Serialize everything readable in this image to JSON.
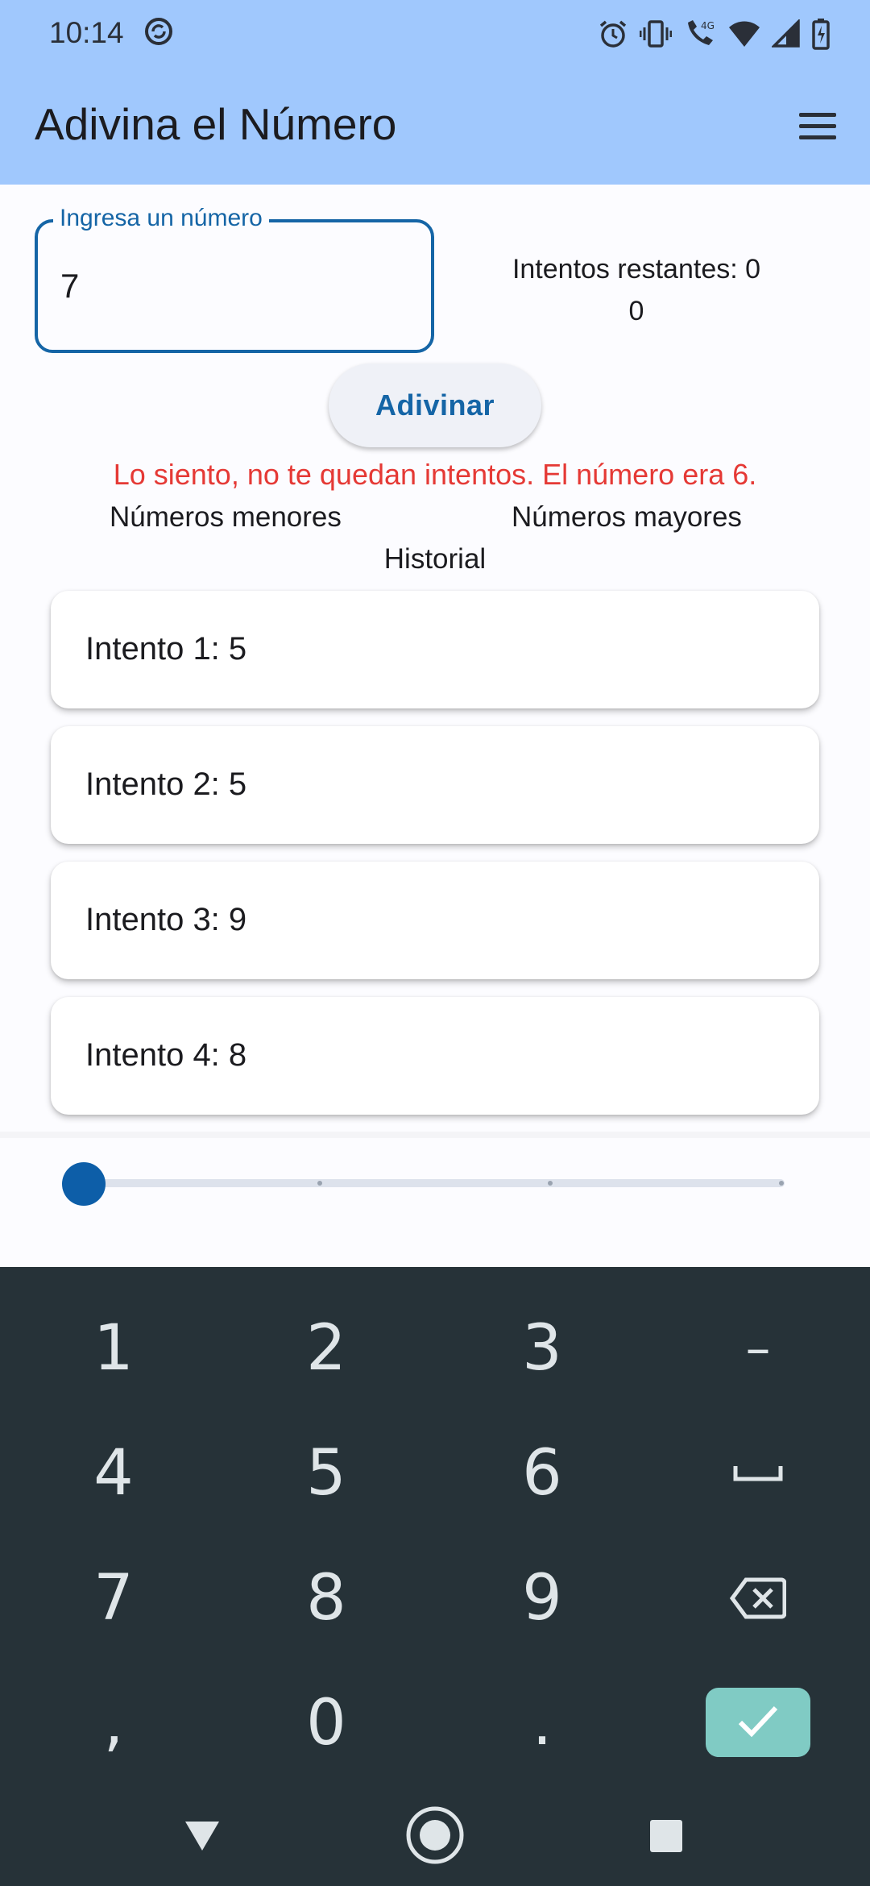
{
  "status_bar": {
    "time": "10:14",
    "icons": [
      "sync-icon",
      "alarm-icon",
      "vibrate-icon",
      "wifi-calling-icon",
      "wifi-icon",
      "signal-icon",
      "battery-charging-icon"
    ],
    "wifi_call_badge": "4G"
  },
  "app_bar": {
    "title": "Adivina el Número",
    "menu_icon": "hamburger-menu-icon"
  },
  "game": {
    "input_label": "Ingresa un número",
    "input_value": "7",
    "remaining_line1": "Intentos restantes: 0",
    "remaining_line2": "0",
    "guess_button": "Adivinar",
    "message": "Lo siento, no te quedan intentos. El número era 6.",
    "message_color": "#e53935",
    "lower_label": "Números menores",
    "higher_label": "Números mayores",
    "history_label": "Historial",
    "history": [
      "Intento 1: 5",
      "Intento 2: 5",
      "Intento 3: 9",
      "Intento 4: 8"
    ],
    "slider": {
      "steps": 4,
      "selected_index": 0
    },
    "accent_color": "#1565a6",
    "app_bar_color": "#a0c8fd"
  },
  "keyboard": {
    "rows": [
      [
        "1",
        "2",
        "3",
        "–"
      ],
      [
        "4",
        "5",
        "6",
        "space-key"
      ],
      [
        "7",
        "8",
        "9",
        "backspace-key"
      ],
      [
        ",",
        "0",
        ".",
        "enter-key"
      ]
    ],
    "background": "#263238",
    "enter_color": "#80cbc4"
  },
  "nav_bar": {
    "buttons": [
      "back-icon",
      "home-icon",
      "recents-icon"
    ]
  }
}
